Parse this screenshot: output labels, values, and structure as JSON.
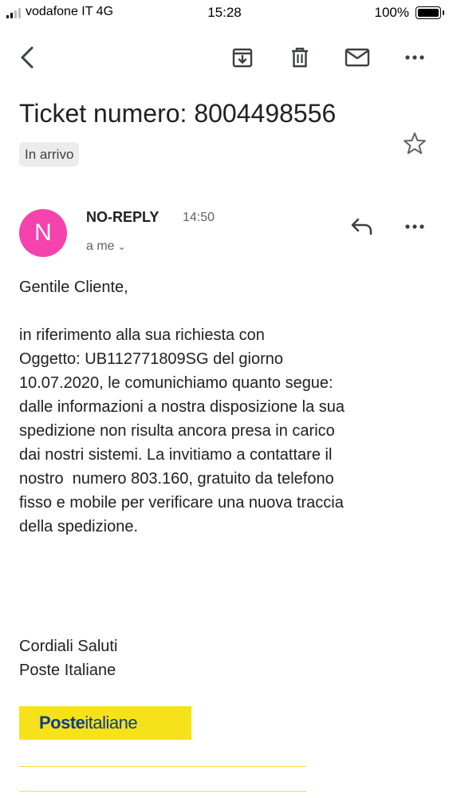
{
  "status_bar": {
    "carrier": "vodafone IT",
    "network": "4G",
    "time": "15:28",
    "battery": "100%"
  },
  "toolbar": {
    "icons": [
      "back-arrow-icon",
      "archive-icon",
      "trash-icon",
      "mail-icon",
      "more-icon"
    ]
  },
  "email": {
    "subject": "Ticket numero: 8004498556",
    "label": "In arrivo",
    "sender": {
      "initial": "N",
      "name": "NO-REPLY",
      "time": "14:50",
      "recipient": "a me",
      "avatar_color": "#f542ad"
    },
    "body": {
      "greeting": "Gentile Cliente,",
      "paragraph_lines": [
        "in riferimento alla sua richiesta con",
        "Oggetto: UB112771809SG del giorno",
        "10.07.2020, le comunichiamo quanto segue:",
        "dalle informazioni a nostra disposizione la sua",
        "spedizione non risulta ancora presa in carico",
        "dai nostri sistemi. La invitiamo a contattare il",
        "nostro  numero 803.160, gratuito da telefono",
        "fisso e mobile per verificare una nuova traccia",
        "della spedizione."
      ],
      "closing": "Cordiali Saluti",
      "signature": "Poste Italiane"
    },
    "logo": {
      "bold_part": "Poste",
      "rest": "italiane",
      "bg_color": "#f7e11b",
      "text_color": "#0a3f8e"
    }
  }
}
